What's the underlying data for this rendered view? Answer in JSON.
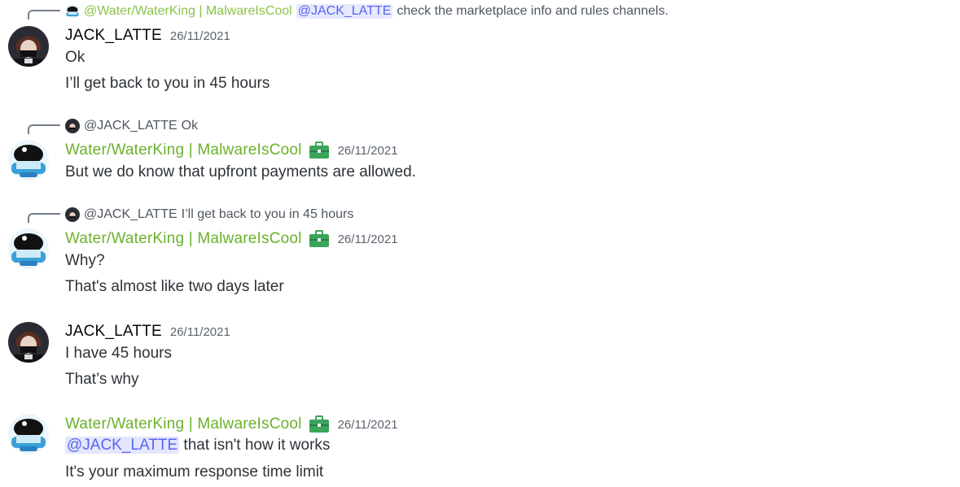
{
  "colors": {
    "water_name": "#6cb12b",
    "mention_text": "#5865f2",
    "mention_bg": "#e4e6fc",
    "timestamp": "#5c6470",
    "message_text": "#2e3338"
  },
  "messages": [
    {
      "reply": {
        "author": "@Water/WaterKing | MalwareIsCool",
        "mention": "@JACK_LATTE",
        "text": "check the marketplace info and rules channels."
      },
      "author": "JACK_LATTE",
      "timestamp": "26/11/2021",
      "lines": [
        "Ok",
        "I’ll get back to you in 45 hours"
      ]
    },
    {
      "reply": {
        "author": "@JACK_LATTE",
        "text": "Ok"
      },
      "author": "Water/WaterKing | MalwareIsCool",
      "badge_icon": "briefcase-icon",
      "timestamp": "26/11/2021",
      "lines": [
        "But we do know that upfront payments are allowed."
      ]
    },
    {
      "reply": {
        "author": "@JACK_LATTE",
        "text": "I’ll get back to you in 45 hours"
      },
      "author": "Water/WaterKing | MalwareIsCool",
      "badge_icon": "briefcase-icon",
      "timestamp": "26/11/2021",
      "lines": [
        "Why?",
        "That's almost like two days later"
      ]
    },
    {
      "author": "JACK_LATTE",
      "timestamp": "26/11/2021",
      "lines": [
        "I have 45 hours",
        "That’s why"
      ]
    },
    {
      "author": "Water/WaterKing | MalwareIsCool",
      "badge_icon": "briefcase-icon",
      "timestamp": "26/11/2021",
      "lines": [
        "that isn't how it works",
        "It's your maximum response time limit"
      ],
      "mention": "@JACK_LATTE"
    }
  ]
}
